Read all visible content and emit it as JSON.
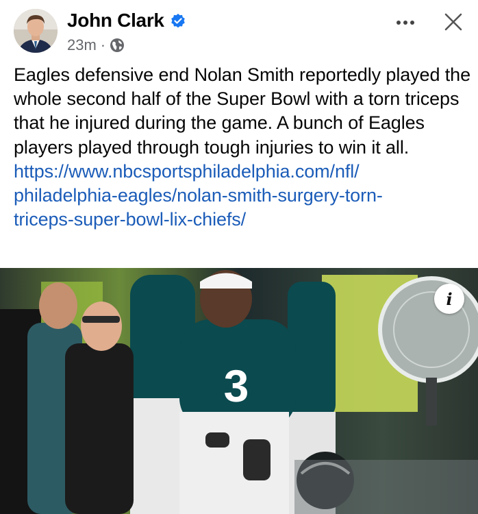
{
  "post": {
    "author": "John Clark",
    "time": "23m",
    "separator": "·",
    "body": "Eagles defensive end Nolan Smith reportedly played the whole second half of the Super Bowl with a torn triceps that he injured during the game. A bunch of Eagles players played through tough injuries to win it all.",
    "link_lines": [
      "https://www.nbcsportsphiladelphia.com/nfl/",
      "philadelphia-eagles/nolan-smith-surgery-torn-",
      "triceps-super-bowl-lix-chiefs/"
    ]
  },
  "header": {
    "more_label": "•••",
    "close_label": "✕"
  },
  "photo": {
    "jersey_number": "3",
    "info_label": "i"
  },
  "icons": {
    "verified": "verified-badge-icon",
    "audience": "globe-icon",
    "more": "more-options-icon",
    "close": "close-icon",
    "info": "info-icon"
  },
  "colors": {
    "link": "#1b5cb8",
    "verified": "#1877f2",
    "meta_text": "#65676b",
    "eagles_green": "#0b4a4f"
  }
}
